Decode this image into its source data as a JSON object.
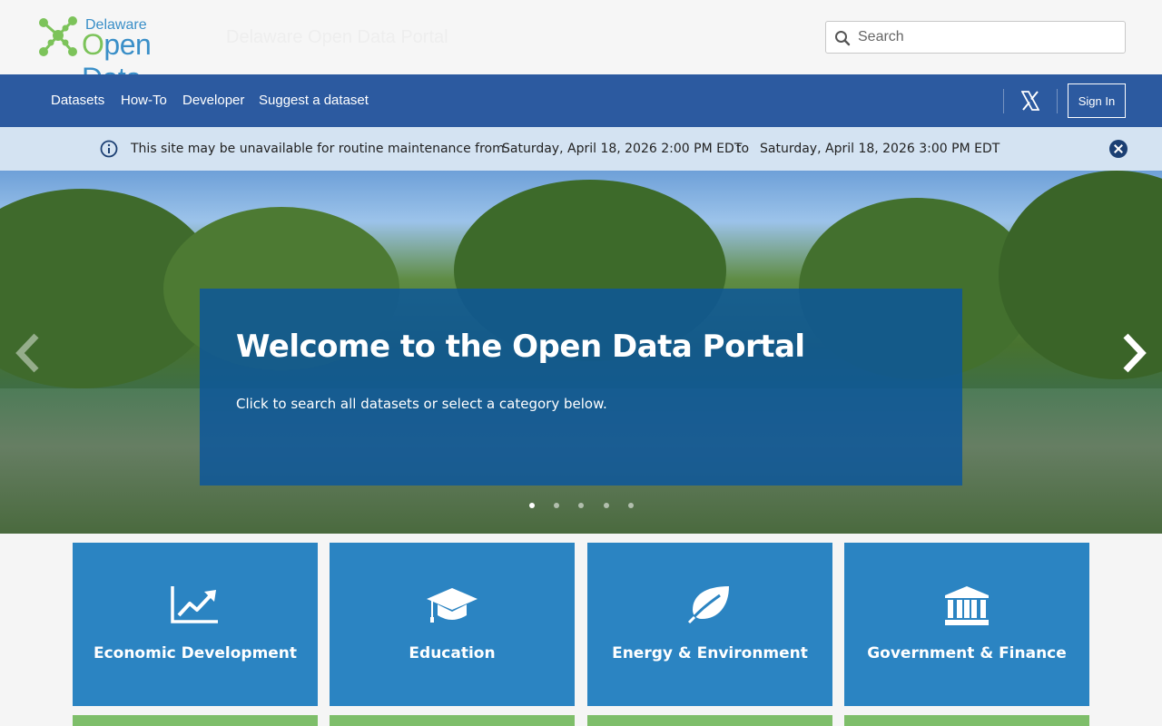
{
  "header": {
    "logo_small": "Delaware",
    "logo_big_prefix": "O",
    "logo_big_rest": "pen Data",
    "site_title": "Delaware Open Data Portal",
    "search_placeholder": "Search"
  },
  "nav": {
    "items": [
      "Datasets",
      "How-To",
      "Developer",
      "Suggest a dataset"
    ],
    "sign_in": "Sign In"
  },
  "banner": {
    "text_1": "This site may be unavailable for routine maintenance from",
    "start": "Saturday, April 18, 2026 2:00 PM EDT",
    "text_2": "to",
    "end": "Saturday, April 18, 2026 3:00 PM EDT",
    "text_3": "."
  },
  "hero": {
    "title": "Welcome to the Open Data Portal",
    "subtitle": "Click to search all datasets or select a category below.",
    "slide_count": 5,
    "active_slide": 1
  },
  "categories": [
    {
      "label": "Economic Development",
      "icon": "chart-line-icon"
    },
    {
      "label": "Education",
      "icon": "graduation-cap-icon"
    },
    {
      "label": "Energy & Environment",
      "icon": "leaf-icon"
    },
    {
      "label": "Government & Finance",
      "icon": "bank-icon"
    }
  ],
  "colors": {
    "nav": "#2c5aa0",
    "banner": "#d4e3f2",
    "tile": "#2b84c2",
    "tile_next_row": "#7ebe6a",
    "logo_blue": "#3a8fc8",
    "logo_green": "#7cc35a"
  }
}
